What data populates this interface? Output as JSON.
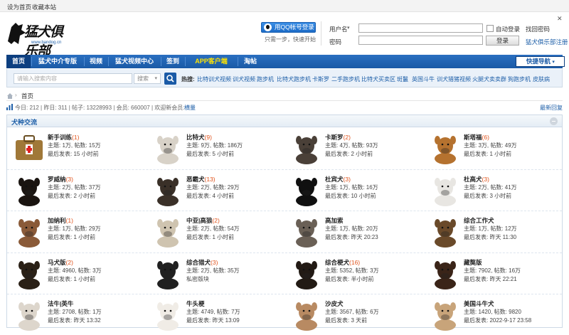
{
  "topbar": {
    "set_home": "设为首页",
    "bookmark": "收藏本站",
    "close_glyph": "✕"
  },
  "logo": {
    "text": "猛犬俱乐部",
    "url": "www.bandog.cn"
  },
  "qq": {
    "login": "用QQ帐号登录",
    "tip": "只需一步，快速开始"
  },
  "login": {
    "username_label": "用户名",
    "password_label": "密码",
    "auto_login": "自动登录",
    "find_password": "找回密码",
    "login_btn": "登录",
    "register": "猛犬俱乐部注册"
  },
  "nav": {
    "items": [
      "首页",
      "猛犬中介专版",
      "视频",
      "猛犬视频中心",
      "签到",
      "APP客户端",
      "淘帖"
    ],
    "quick": "快捷导航"
  },
  "search": {
    "placeholder": "请输入搜索内容",
    "scope": "搜索",
    "hot_label": "热搜:",
    "hot": [
      "比特训犬视频",
      "训犬视频",
      "跑步机",
      "比特犬跑步机",
      "卡斯罗",
      "二手跑步机",
      "比特犬买卖区",
      "斑鬣",
      "英国斗牛",
      "训犬猎猪视频",
      "火腿犬卖卖群",
      "狗跑步机",
      "皮肤病"
    ]
  },
  "crumb": {
    "home": "首页"
  },
  "stats": {
    "text": "今日: 212 | 昨日: 311 | 帖子: 13228993 | 会员: 660007 | 欢迎新会员: ",
    "newest_member": "横量",
    "latest": "最新回复"
  },
  "section": {
    "title": "犬种交流"
  },
  "colors": {
    "nav": "#1a5aa6",
    "link": "#1e5fa8",
    "count": "#e0531c"
  },
  "forums": [
    {
      "name": "新手训练",
      "count": "(1)",
      "topics": "主题: 1万, 帖数: 15万",
      "last": "最后发表: 15 小时前"
    },
    {
      "name": "比特犬",
      "count": "(9)",
      "topics": "主题: 9万, 帖数: 186万",
      "last": "最后发表: 5 小时前"
    },
    {
      "name": "卡斯罗",
      "count": "(2)",
      "topics": "主题: 4万, 帖数: 93万",
      "last": "最后发表: 2 小时前"
    },
    {
      "name": "斯塔福",
      "count": "(6)",
      "topics": "主题: 3万, 帖数: 49万",
      "last": "最后发表: 1 小时前"
    },
    {
      "name": "罗威纳",
      "count": "(3)",
      "topics": "主题: 2万, 帖数: 37万",
      "last": "最后发表: 2 小时前"
    },
    {
      "name": "恶霸犬",
      "count": "(13)",
      "topics": "主题: 2万, 帖数: 29万",
      "last": "最后发表: 4 小时前"
    },
    {
      "name": "杜宾犬",
      "count": "(3)",
      "topics": "主题: 1万, 帖数: 16万",
      "last": "最后发表: 10 小时前"
    },
    {
      "name": "杜高犬",
      "count": "(3)",
      "topics": "主题: 2万, 帖数: 41万",
      "last": "最后发表: 3 小时前"
    },
    {
      "name": "加纳利",
      "count": "(1)",
      "topics": "主题: 1万, 帖数: 29万",
      "last": "最后发表: 1 小时前"
    },
    {
      "name": "中亚|高狼",
      "count": "(2)",
      "topics": "主题: 2万, 帖数: 54万",
      "last": "最后发表: 1 小时前"
    },
    {
      "name": "高加索",
      "count": "",
      "topics": "主题: 1万, 帖数: 20万",
      "last": "最后发表: 昨天 20:23"
    },
    {
      "name": "综合工作犬",
      "count": "",
      "topics": "主题: 1万, 帖数: 12万",
      "last": "最后发表: 昨天 11:30"
    },
    {
      "name": "马犬版",
      "count": "(2)",
      "topics": "主题: 4960, 帖数: 3万",
      "last": "最后发表: 1 小时前"
    },
    {
      "name": "综合猎犬",
      "count": "(3)",
      "topics": "主题: 2万, 帖数: 35万",
      "last": "私密版块"
    },
    {
      "name": "综合梗犬",
      "count": "(16)",
      "topics": "主题: 5352, 帖数: 3万",
      "last": "最后发表: 半小时前"
    },
    {
      "name": "藏獒版",
      "count": "",
      "topics": "主题: 7902, 帖数: 16万",
      "last": "最后发表: 昨天 22:21"
    },
    {
      "name": "法牛|英牛",
      "count": "",
      "topics": "主题: 2708, 帖数: 1万",
      "last": "最后发表: 昨天 13:32"
    },
    {
      "name": "牛头梗",
      "count": "",
      "topics": "主题: 4749, 帖数: 7万",
      "last": "最后发表: 昨天 13:09"
    },
    {
      "name": "沙皮犬",
      "count": "",
      "topics": "主题: 3567, 帖数: 6万",
      "last": "最后发表: 3 天前"
    },
    {
      "name": "美国斗牛犬",
      "count": "",
      "topics": "主题: 1420, 帖数: 9820",
      "last": "最后发表: 2022-9-17 23:58"
    }
  ]
}
